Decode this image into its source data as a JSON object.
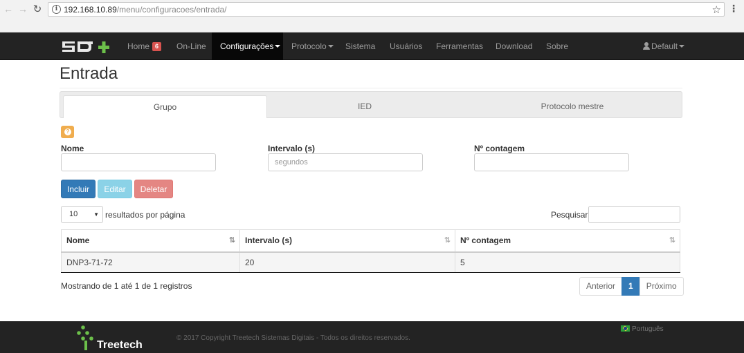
{
  "browser": {
    "url_host": "192.168.10.89",
    "url_path": "/menu/configuracoes/entrada/"
  },
  "navbar": {
    "items": [
      {
        "label": "Home",
        "badge": "6"
      },
      {
        "label": "On-Line"
      },
      {
        "label": "Configurações",
        "dropdown": true,
        "active": true
      },
      {
        "label": "Protocolo",
        "dropdown": true
      },
      {
        "label": "Sistema"
      },
      {
        "label": "Usuários"
      },
      {
        "label": "Ferramentas"
      },
      {
        "label": "Download"
      },
      {
        "label": "Sobre"
      }
    ],
    "user": "Default"
  },
  "page": {
    "title": "Entrada",
    "tabs": [
      "Grupo",
      "IED",
      "Protocolo mestre"
    ],
    "active_tab": "Grupo"
  },
  "form": {
    "nome_label": "Nome",
    "nome_value": "",
    "intervalo_label": "Intervalo (s)",
    "intervalo_placeholder": "segundos",
    "contagem_label": "Nº contagem",
    "contagem_value": "",
    "buttons": {
      "incluir": "Incluir",
      "editar": "Editar",
      "deletar": "Deletar"
    }
  },
  "table": {
    "page_size": "10",
    "per_page_label": "resultados por página",
    "search_label": "Pesquisar",
    "columns": [
      "Nome",
      "Intervalo (s)",
      "Nº contagem"
    ],
    "rows": [
      [
        "DNP3-71-72",
        "20",
        "5"
      ]
    ],
    "info": "Mostrando de 1 até 1 de 1 registros",
    "pagination": {
      "prev": "Anterior",
      "current": "1",
      "next": "Próximo"
    }
  },
  "footer": {
    "brand": "Treetech",
    "copyright": "© 2017 Copyright Treetech Sistemas Digitais - Todos os direitos reservados.",
    "language": "Português"
  },
  "colors": {
    "navbar_bg": "#232323",
    "primary": "#337ab7",
    "info": "#5bc0de",
    "danger": "#d9534f",
    "warning": "#f0ad4e",
    "logo_green": "#6cc04a"
  }
}
